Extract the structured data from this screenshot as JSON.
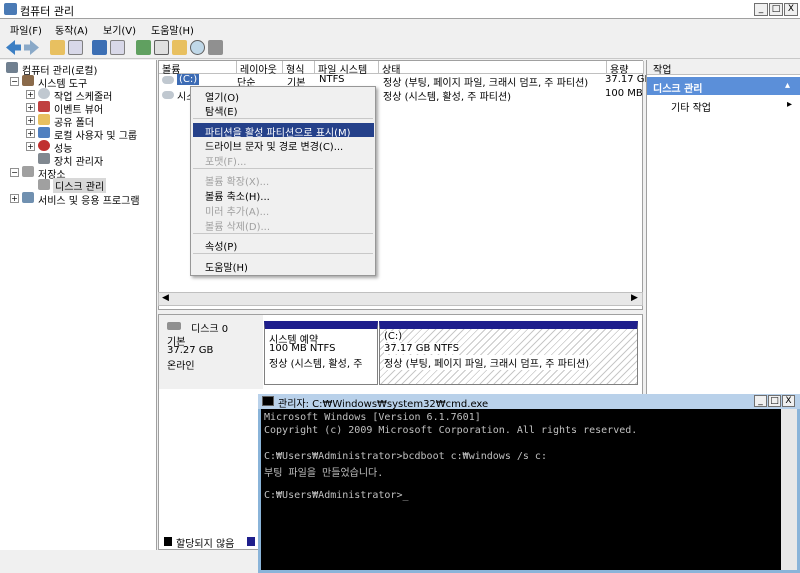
{
  "window": {
    "title": "컴퓨터 관리",
    "min": "_",
    "max": "□",
    "close": "X"
  },
  "menu": [
    "파일(F)",
    "동작(A)",
    "보기(V)",
    "도움말(H)"
  ],
  "tree": {
    "root": "컴퓨터 관리(로컬)",
    "system_tools": "시스템 도구",
    "items": [
      "작업 스케줄러",
      "이벤트 뷰어",
      "공유 폴더",
      "로컬 사용자 및 그룹",
      "성능",
      "장치 관리자"
    ],
    "storage": "저장소",
    "disk_mgmt": "디스크 관리",
    "services": "서비스 및 응용 프로그램"
  },
  "volume_list": {
    "headers": [
      "볼륨",
      "레이아웃",
      "형식",
      "파일 시스템",
      "상태",
      "용량"
    ],
    "rows": [
      {
        "volume": "(C:)",
        "layout": "단순",
        "type": "기본",
        "fs": "NTFS",
        "status": "정상 (부팅, 페이지 파일, 크래시 덤프, 주 파티션)",
        "capacity": "37.17 GB"
      },
      {
        "volume": "시스",
        "layout": "",
        "type": "",
        "fs": "",
        "status": "정상 (시스템, 활성, 주 파티션)",
        "capacity": "100 MB"
      }
    ]
  },
  "context_menu": [
    {
      "label": "열기(O)",
      "disabled": false
    },
    {
      "label": "탐색(E)",
      "disabled": false
    },
    {
      "label": "파티션을 활성 파티션으로 표시(M)",
      "disabled": false
    },
    {
      "label": "드라이브 문자 및 경로 변경(C)...",
      "disabled": false
    },
    {
      "label": "포맷(F)...",
      "disabled": true
    },
    {
      "label": "볼륨 확장(X)...",
      "disabled": true
    },
    {
      "label": "볼륨 축소(H)...",
      "disabled": false
    },
    {
      "label": "미러 추가(A)...",
      "disabled": true
    },
    {
      "label": "볼륨 삭제(D)...",
      "disabled": true
    },
    {
      "label": "속성(P)",
      "disabled": false
    },
    {
      "label": "도움말(H)",
      "disabled": false
    }
  ],
  "disk": {
    "name": "디스크 0",
    "type": "기본",
    "size": "37.27 GB",
    "state": "온라인",
    "part1_name": "시스템 예약",
    "part1_size": "100 MB NTFS",
    "part1_status": "정상 (시스템, 활성, 주 ",
    "part2_name": "(C:)",
    "part2_size": "37.17 GB NTFS",
    "part2_status": "정상 (부팅, 페이지 파일, 크래시 덤프, 주 파티션)"
  },
  "legend": "할당되지 않음",
  "actions": {
    "header": "작업",
    "section": "디스크 관리",
    "more": "기타 작업"
  },
  "cmd": {
    "title": "관리자: C:₩Windows₩system32₩cmd.exe",
    "lines": [
      "Microsoft Windows [Version 6.1.7601]",
      "Copyright (c) 2009 Microsoft Corporation. All rights reserved.",
      "",
      "C:₩Users₩Administrator>bcdboot c:₩windows /s c:",
      "부팅 파일을 만들었습니다.",
      "",
      "C:₩Users₩Administrator>_"
    ]
  }
}
